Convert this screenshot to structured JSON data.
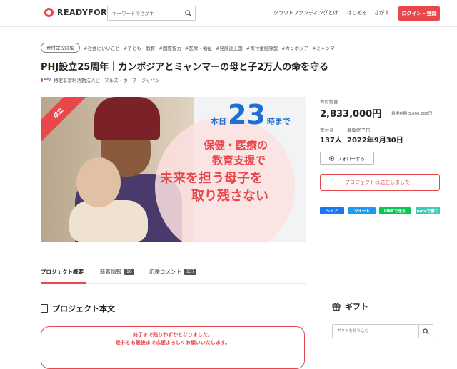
{
  "header": {
    "logo_text": "READYFOR",
    "search_placeholder": "キーワードでさがす",
    "nav": [
      "クラウドファンディングとは",
      "はじめる",
      "さがす"
    ],
    "login_label": "ログイン・登録"
  },
  "project": {
    "badge": "寄付金控除型",
    "tags": [
      "#社会にいいこと",
      "#子ども・教育",
      "#国際協力",
      "#医療・福祉",
      "#発展途上国",
      "#寄付金控除型",
      "#カンボジア",
      "#ミャンマー"
    ],
    "title": "PHJ設立25周年｜カンボジアとミャンマーの母と子2万人の命を守る",
    "org_logo": "PHJ",
    "org_name": "特定非営利活動法人ピープルズ・ホープ・ジャパン"
  },
  "hero": {
    "ribbon": "成立",
    "countdown_prefix": "本日",
    "countdown_number": "23",
    "countdown_suffix": "時まで",
    "line1": "保健・医療の",
    "line2": "教育支援で",
    "line3": "未来を担う母子を",
    "line4": "取り残さない"
  },
  "stats": {
    "total_label": "寄付総額",
    "total_value": "2,833,000円",
    "goal": "目標金額 3,000,000円",
    "supporters_label": "寄付者",
    "supporters_value": "137人",
    "end_label": "募集終了日",
    "end_value": "2022年9月30日",
    "follow_label": "フォローする",
    "status_label": "プロジェクトは成立しました！"
  },
  "share": [
    {
      "label": "シェア",
      "color": "#1877f2"
    },
    {
      "label": "ツイート",
      "color": "#1d9bf0"
    },
    {
      "label": "LINEで送る",
      "color": "#06c755"
    },
    {
      "label": "noteで書く",
      "color": "#41c9b4"
    }
  ],
  "tabs": [
    {
      "label": "プロジェクト概要",
      "count": ""
    },
    {
      "label": "新着情報",
      "count": "16"
    },
    {
      "label": "応援コメント",
      "count": "137"
    }
  ],
  "body": {
    "section_title": "プロジェクト本文",
    "notice_line1": "終了まで残りわずかとなりました。",
    "notice_line2": "是非とも最後まで応援よろしくお願いいたします。"
  },
  "gift": {
    "title": "ギフト",
    "search_placeholder": "ギフトを絞り込む"
  }
}
